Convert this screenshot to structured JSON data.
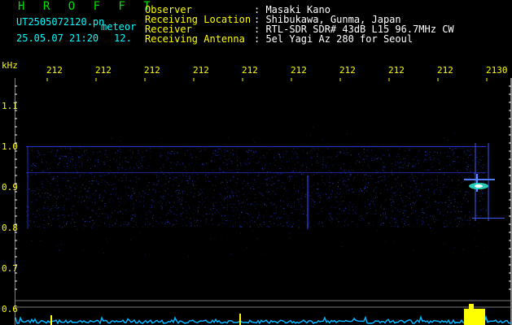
{
  "header": {
    "logo": "H R O F F T",
    "filename": "UT2505072120.pn",
    "mode": "meteor",
    "datetime": "25.05.07 21:20",
    "frame": "12.",
    "info": [
      {
        "label": "Observer",
        "value": ": Masaki Kano"
      },
      {
        "label": "Receiving Location",
        "value": ": Shibukawa, Gunma, Japan"
      },
      {
        "label": "Receiver",
        "value": ": RTL-SDR SDR# 43dB L15 96.7MHz CW"
      },
      {
        "label": "Receiving Antenna",
        "value": ": 5el Yagi Az 280 for Seoul"
      }
    ]
  },
  "axis": {
    "y_unit": "kHz",
    "y_ticks": [
      "1.1",
      "1.0",
      "0.9",
      "0.8",
      "0.7",
      "0.6"
    ],
    "x_ticks": [
      "212",
      "212",
      "212",
      "212",
      "212",
      "212",
      "212",
      "212",
      "212",
      "2130"
    ]
  },
  "colors": {
    "background": "#000000",
    "tick_text": "#ffff00",
    "signal": "#2a3cff",
    "echo": "#ffffff",
    "spectrum": "#00b4ff"
  }
}
